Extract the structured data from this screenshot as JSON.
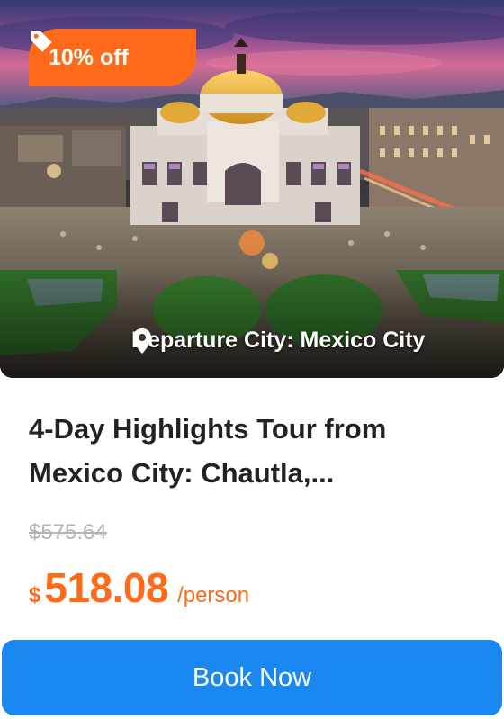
{
  "badge": {
    "text": "10% off",
    "icon": "tag-icon",
    "color": "#ff6a1a"
  },
  "hero": {
    "departure_text": "Departure City: Mexico City",
    "icon": "location-pin-icon"
  },
  "tour": {
    "title": "4-Day Highlights Tour from Mexico City: Chautla,..."
  },
  "pricing": {
    "original_price": "$575.64",
    "currency_symbol": "$",
    "price": "518.08",
    "unit": "/person",
    "accent_color": "#ff6a1a"
  },
  "cta": {
    "label": "Book Now",
    "color": "#1a88f0"
  }
}
